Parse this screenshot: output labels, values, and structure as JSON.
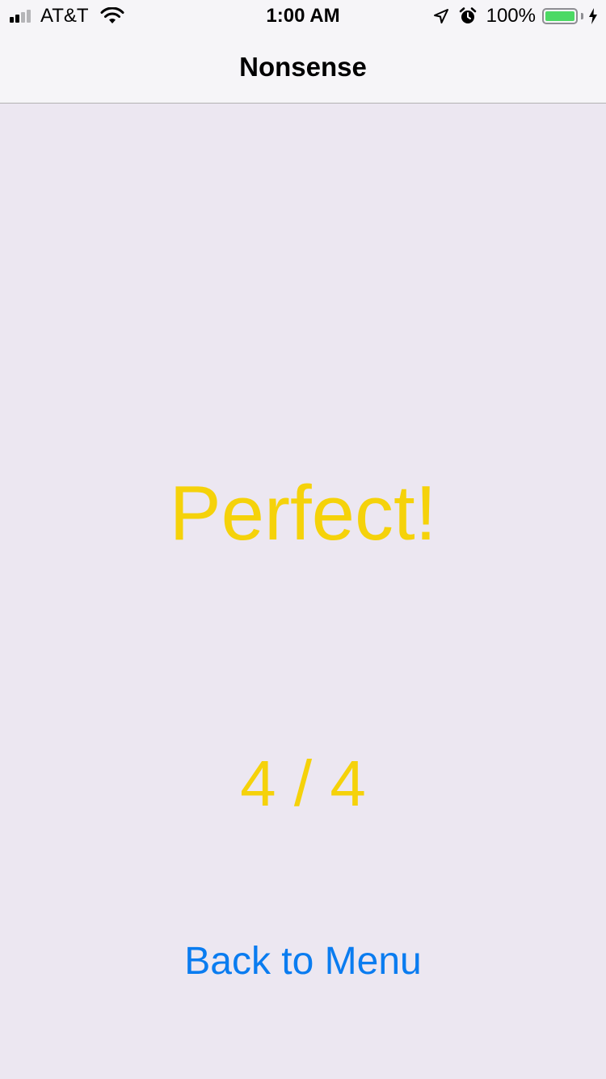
{
  "status_bar": {
    "carrier": "AT&T",
    "time": "1:00 AM",
    "battery_percent": "100%",
    "battery_level": 1.0,
    "icons": [
      "signal-icon",
      "wifi-icon",
      "location-arrow-icon",
      "alarm-icon",
      "battery-icon",
      "charging-bolt-icon"
    ]
  },
  "nav": {
    "title": "Nonsense"
  },
  "result": {
    "message": "Perfect!",
    "score": "4 / 4"
  },
  "actions": {
    "back_label": "Back to Menu"
  },
  "colors": {
    "background": "#ece7f1",
    "result_text": "#f5d20a",
    "link": "#0a7cf0",
    "battery_fill": "#4cd964"
  }
}
